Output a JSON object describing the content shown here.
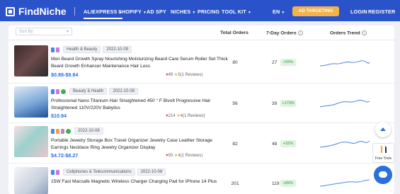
{
  "app": {
    "logo": "FindNiche"
  },
  "nav": {
    "items": [
      "ALIEXPRESS",
      "SHOPIFY",
      "AD SPY",
      "NICHES",
      "PRICING",
      "TOOL KIT"
    ],
    "lang": "EN",
    "ad_targeting": "AD TARGETING",
    "login": "LOGIN",
    "register": "REGISTER"
  },
  "table": {
    "sort_placeholder": "Sort By",
    "col_total": "Total Orders",
    "col_7day": "7-Day Orders",
    "col_trend": "Orders Trend",
    "rows": [
      {
        "tags": [
          "Health & Beauty",
          "2022-10-09"
        ],
        "title": "Men Beard Growth Spray Nourishing Moisturizing Beard Care Serum Roller Set Thick Beard Growth Enhancer Maintenance Hair Loss",
        "price": "$0.88-$9.84",
        "wish": "49",
        "rating": "5(1 Reviews)",
        "total": "80",
        "seven": "27",
        "badge": "+59%"
      },
      {
        "tags": [
          "Beauty & Health",
          "2022-10-08"
        ],
        "title": "Professional Nano Titanium Hair Straightened 450 ° F Bivolt Progressive Hair Straightened 110V/220V Babyliss",
        "price": "$10.94",
        "wish": "214",
        "rating": "4(1 Reviews)",
        "total": "56",
        "seven": "39",
        "badge": "+179%"
      },
      {
        "tags": [
          "2022-10-08"
        ],
        "title": "Portable Jewelry Storage Box Travel Organizer Jewelry Case Leather Storage Earrings Necklace Ring Jewelry Organizer Display",
        "price": "$4.72-$8.27",
        "wish": "93",
        "rating": "4(1 Reviews)",
        "total": "82",
        "seven": "48",
        "badge": "+32%"
      },
      {
        "tags": [
          "Cellphones & Telecommunications",
          "2022-10-08"
        ],
        "title": "15W Fast Macsafe Magnetic Wireless Charger Charging Pad for iPhone 14 Plus",
        "price": "",
        "wish": "",
        "rating": "",
        "total": "201",
        "seven": "119",
        "badge": "+89%"
      }
    ]
  },
  "widgets": {
    "free_tools": "Free Tools"
  },
  "colors": {
    "brand": "#2a52c9",
    "accent": "#f3b24a",
    "price": "#2a6fe0",
    "positive": "#38a048"
  }
}
